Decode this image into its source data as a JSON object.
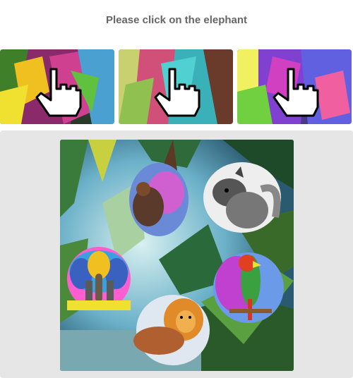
{
  "challenge": {
    "instruction": "Please click on the elephant"
  },
  "examples": [
    {
      "name": "example-1",
      "cursor_icon": "hand-pointer-icon",
      "hue": "#a03080"
    },
    {
      "name": "example-2",
      "cursor_icon": "hand-pointer-icon",
      "hue": "#30a0b0"
    },
    {
      "name": "example-3",
      "cursor_icon": "hand-pointer-icon",
      "hue": "#7040c0"
    }
  ],
  "scene": {
    "background": "jungle",
    "targets": [
      "elephant",
      "squirrel",
      "bear",
      "parrot",
      "lion"
    ]
  },
  "colors": {
    "title": "#666666",
    "panel": "#e6e6e6"
  }
}
